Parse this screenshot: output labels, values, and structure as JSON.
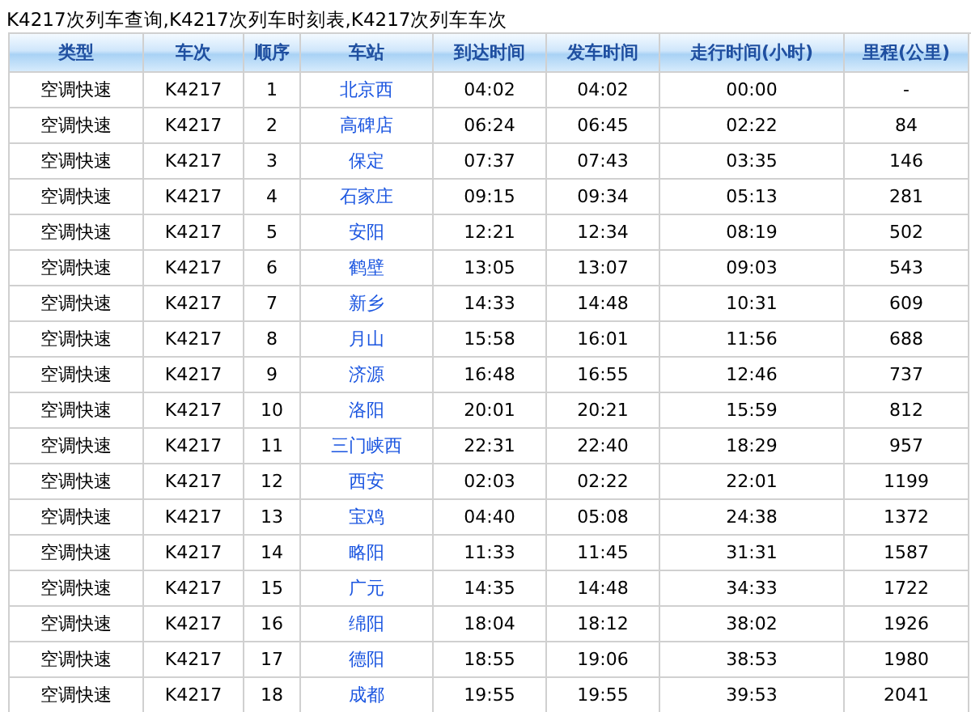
{
  "title": "K4217次列车查询,K4217次列车时刻表,K4217次列车车次",
  "table": {
    "columns": [
      "类型",
      "车次",
      "顺序",
      "车站",
      "到达时间",
      "发车时间",
      "走行时间(小时)",
      "里程(公里)"
    ],
    "rows": [
      {
        "type": "空调快速",
        "train": "K4217",
        "seq": "1",
        "station": "北京西",
        "arrive": "04:02",
        "depart": "04:02",
        "elapsed": "00:00",
        "distance": "-"
      },
      {
        "type": "空调快速",
        "train": "K4217",
        "seq": "2",
        "station": "高碑店",
        "arrive": "06:24",
        "depart": "06:45",
        "elapsed": "02:22",
        "distance": "84"
      },
      {
        "type": "空调快速",
        "train": "K4217",
        "seq": "3",
        "station": "保定",
        "arrive": "07:37",
        "depart": "07:43",
        "elapsed": "03:35",
        "distance": "146"
      },
      {
        "type": "空调快速",
        "train": "K4217",
        "seq": "4",
        "station": "石家庄",
        "arrive": "09:15",
        "depart": "09:34",
        "elapsed": "05:13",
        "distance": "281"
      },
      {
        "type": "空调快速",
        "train": "K4217",
        "seq": "5",
        "station": "安阳",
        "arrive": "12:21",
        "depart": "12:34",
        "elapsed": "08:19",
        "distance": "502"
      },
      {
        "type": "空调快速",
        "train": "K4217",
        "seq": "6",
        "station": "鹤壁",
        "arrive": "13:05",
        "depart": "13:07",
        "elapsed": "09:03",
        "distance": "543"
      },
      {
        "type": "空调快速",
        "train": "K4217",
        "seq": "7",
        "station": "新乡",
        "arrive": "14:33",
        "depart": "14:48",
        "elapsed": "10:31",
        "distance": "609"
      },
      {
        "type": "空调快速",
        "train": "K4217",
        "seq": "8",
        "station": "月山",
        "arrive": "15:58",
        "depart": "16:01",
        "elapsed": "11:56",
        "distance": "688"
      },
      {
        "type": "空调快速",
        "train": "K4217",
        "seq": "9",
        "station": "济源",
        "arrive": "16:48",
        "depart": "16:55",
        "elapsed": "12:46",
        "distance": "737"
      },
      {
        "type": "空调快速",
        "train": "K4217",
        "seq": "10",
        "station": "洛阳",
        "arrive": "20:01",
        "depart": "20:21",
        "elapsed": "15:59",
        "distance": "812"
      },
      {
        "type": "空调快速",
        "train": "K4217",
        "seq": "11",
        "station": "三门峡西",
        "arrive": "22:31",
        "depart": "22:40",
        "elapsed": "18:29",
        "distance": "957"
      },
      {
        "type": "空调快速",
        "train": "K4217",
        "seq": "12",
        "station": "西安",
        "arrive": "02:03",
        "depart": "02:22",
        "elapsed": "22:01",
        "distance": "1199"
      },
      {
        "type": "空调快速",
        "train": "K4217",
        "seq": "13",
        "station": "宝鸡",
        "arrive": "04:40",
        "depart": "05:08",
        "elapsed": "24:38",
        "distance": "1372"
      },
      {
        "type": "空调快速",
        "train": "K4217",
        "seq": "14",
        "station": "略阳",
        "arrive": "11:33",
        "depart": "11:45",
        "elapsed": "31:31",
        "distance": "1587"
      },
      {
        "type": "空调快速",
        "train": "K4217",
        "seq": "15",
        "station": "广元",
        "arrive": "14:35",
        "depart": "14:48",
        "elapsed": "34:33",
        "distance": "1722"
      },
      {
        "type": "空调快速",
        "train": "K4217",
        "seq": "16",
        "station": "绵阳",
        "arrive": "18:04",
        "depart": "18:12",
        "elapsed": "38:02",
        "distance": "1926"
      },
      {
        "type": "空调快速",
        "train": "K4217",
        "seq": "17",
        "station": "德阳",
        "arrive": "18:55",
        "depart": "19:06",
        "elapsed": "38:53",
        "distance": "1980"
      },
      {
        "type": "空调快速",
        "train": "K4217",
        "seq": "18",
        "station": "成都",
        "arrive": "19:55",
        "depart": "19:55",
        "elapsed": "39:53",
        "distance": "2041"
      }
    ]
  }
}
